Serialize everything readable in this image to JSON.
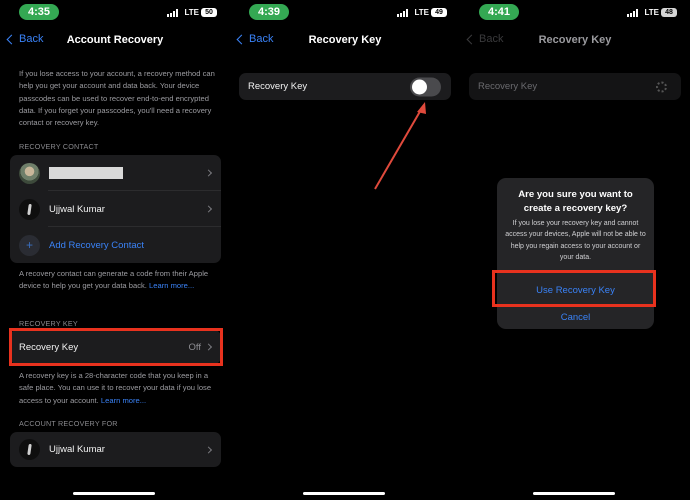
{
  "colors": {
    "accent": "#3a82f6",
    "highlight": "#e8321e",
    "time_pill": "#34a853",
    "group_bg": "#1c1c1e"
  },
  "screens": [
    {
      "status": {
        "time": "4:35",
        "network": "LTE",
        "battery": "50",
        "signal_icon": "signal-bars-icon"
      },
      "nav": {
        "back_label": "Back",
        "title": "Account Recovery"
      },
      "intro": "If you lose access to your account, a recovery method can help you get your account and data back. Your device passcodes can be used to recover end-to-end encrypted data. If you forget your passcodes, you'll need a recovery contact or recovery key.",
      "recovery_contact": {
        "header": "RECOVERY CONTACT",
        "contacts": [
          {
            "name": "",
            "redacted": true
          },
          {
            "name": "Ujjwal Kumar"
          }
        ],
        "add_label": "Add Recovery Contact",
        "note": "A recovery contact can generate a code from their Apple device to help you get your data back.",
        "note_link": "Learn more..."
      },
      "recovery_key": {
        "header": "RECOVERY KEY",
        "label": "Recovery Key",
        "value": "Off",
        "note": "A recovery key is a 28-character code that you keep in a safe place. You can use it to recover your data if you lose access to your account.",
        "note_link": "Learn more..."
      },
      "account_recovery_for": {
        "header": "ACCOUNT RECOVERY FOR",
        "name": "Ujjwal Kumar"
      }
    },
    {
      "status": {
        "time": "4:39",
        "network": "LTE",
        "battery": "49"
      },
      "nav": {
        "back_label": "Back",
        "title": "Recovery Key"
      },
      "toggle_row": {
        "label": "Recovery Key",
        "state": "off"
      }
    },
    {
      "status": {
        "time": "4:41",
        "network": "LTE",
        "battery": "48"
      },
      "nav": {
        "back_label": "Back",
        "title": "Recovery Key"
      },
      "toggle_row": {
        "label": "Recovery Key",
        "state": "loading"
      },
      "alert": {
        "title": "Are you sure you want to create a recovery key?",
        "message": "If you lose your recovery key and cannot access your devices, Apple will not be able to help you regain access to your account or your data.",
        "primary": "Use Recovery Key",
        "cancel": "Cancel"
      }
    }
  ]
}
